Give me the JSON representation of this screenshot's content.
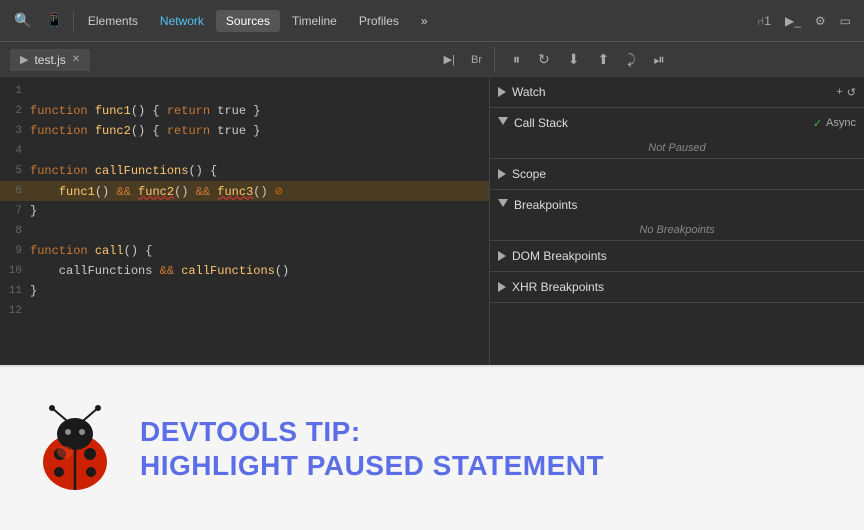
{
  "toolbar": {
    "tabs": [
      {
        "label": "Elements",
        "active": false
      },
      {
        "label": "Network",
        "active": false
      },
      {
        "label": "Sources",
        "active": true
      },
      {
        "label": "Timeline",
        "active": false
      },
      {
        "label": "Profiles",
        "active": false
      }
    ],
    "right_items": [
      "⑁1",
      "▶_",
      "⚙",
      "▭"
    ]
  },
  "debug": {
    "file_tab": "test.js",
    "controls": [
      "⏸",
      "↻",
      "⬇",
      "⬆",
      "⤸",
      "⏯"
    ]
  },
  "right_panel": {
    "watch_label": "Watch",
    "watch_add": "+",
    "watch_refresh": "↺",
    "call_stack_label": "Call Stack",
    "call_stack_async": "Async",
    "call_stack_status": "Not Paused",
    "scope_label": "Scope",
    "breakpoints_label": "Breakpoints",
    "breakpoints_status": "No Breakpoints",
    "dom_breakpoints_label": "DOM Breakpoints",
    "xhr_breakpoints_label": "XHR Breakpoints"
  },
  "code": {
    "lines": [
      {
        "num": 1,
        "text": ""
      },
      {
        "num": 2,
        "text": "function func1() { return true }"
      },
      {
        "num": 3,
        "text": "function func2() { return true }"
      },
      {
        "num": 4,
        "text": ""
      },
      {
        "num": 5,
        "text": "function callFunctions() {"
      },
      {
        "num": 6,
        "text": "    func1() && func2() && func3()"
      },
      {
        "num": 7,
        "text": "}"
      },
      {
        "num": 8,
        "text": ""
      },
      {
        "num": 9,
        "text": "function call() {"
      },
      {
        "num": 10,
        "text": "    callFunctions && callFunctions()"
      },
      {
        "num": 11,
        "text": "}"
      },
      {
        "num": 12,
        "text": ""
      }
    ]
  },
  "tip": {
    "title": "DevTools Tip:",
    "subtitle": "Highlight Paused Statement"
  }
}
